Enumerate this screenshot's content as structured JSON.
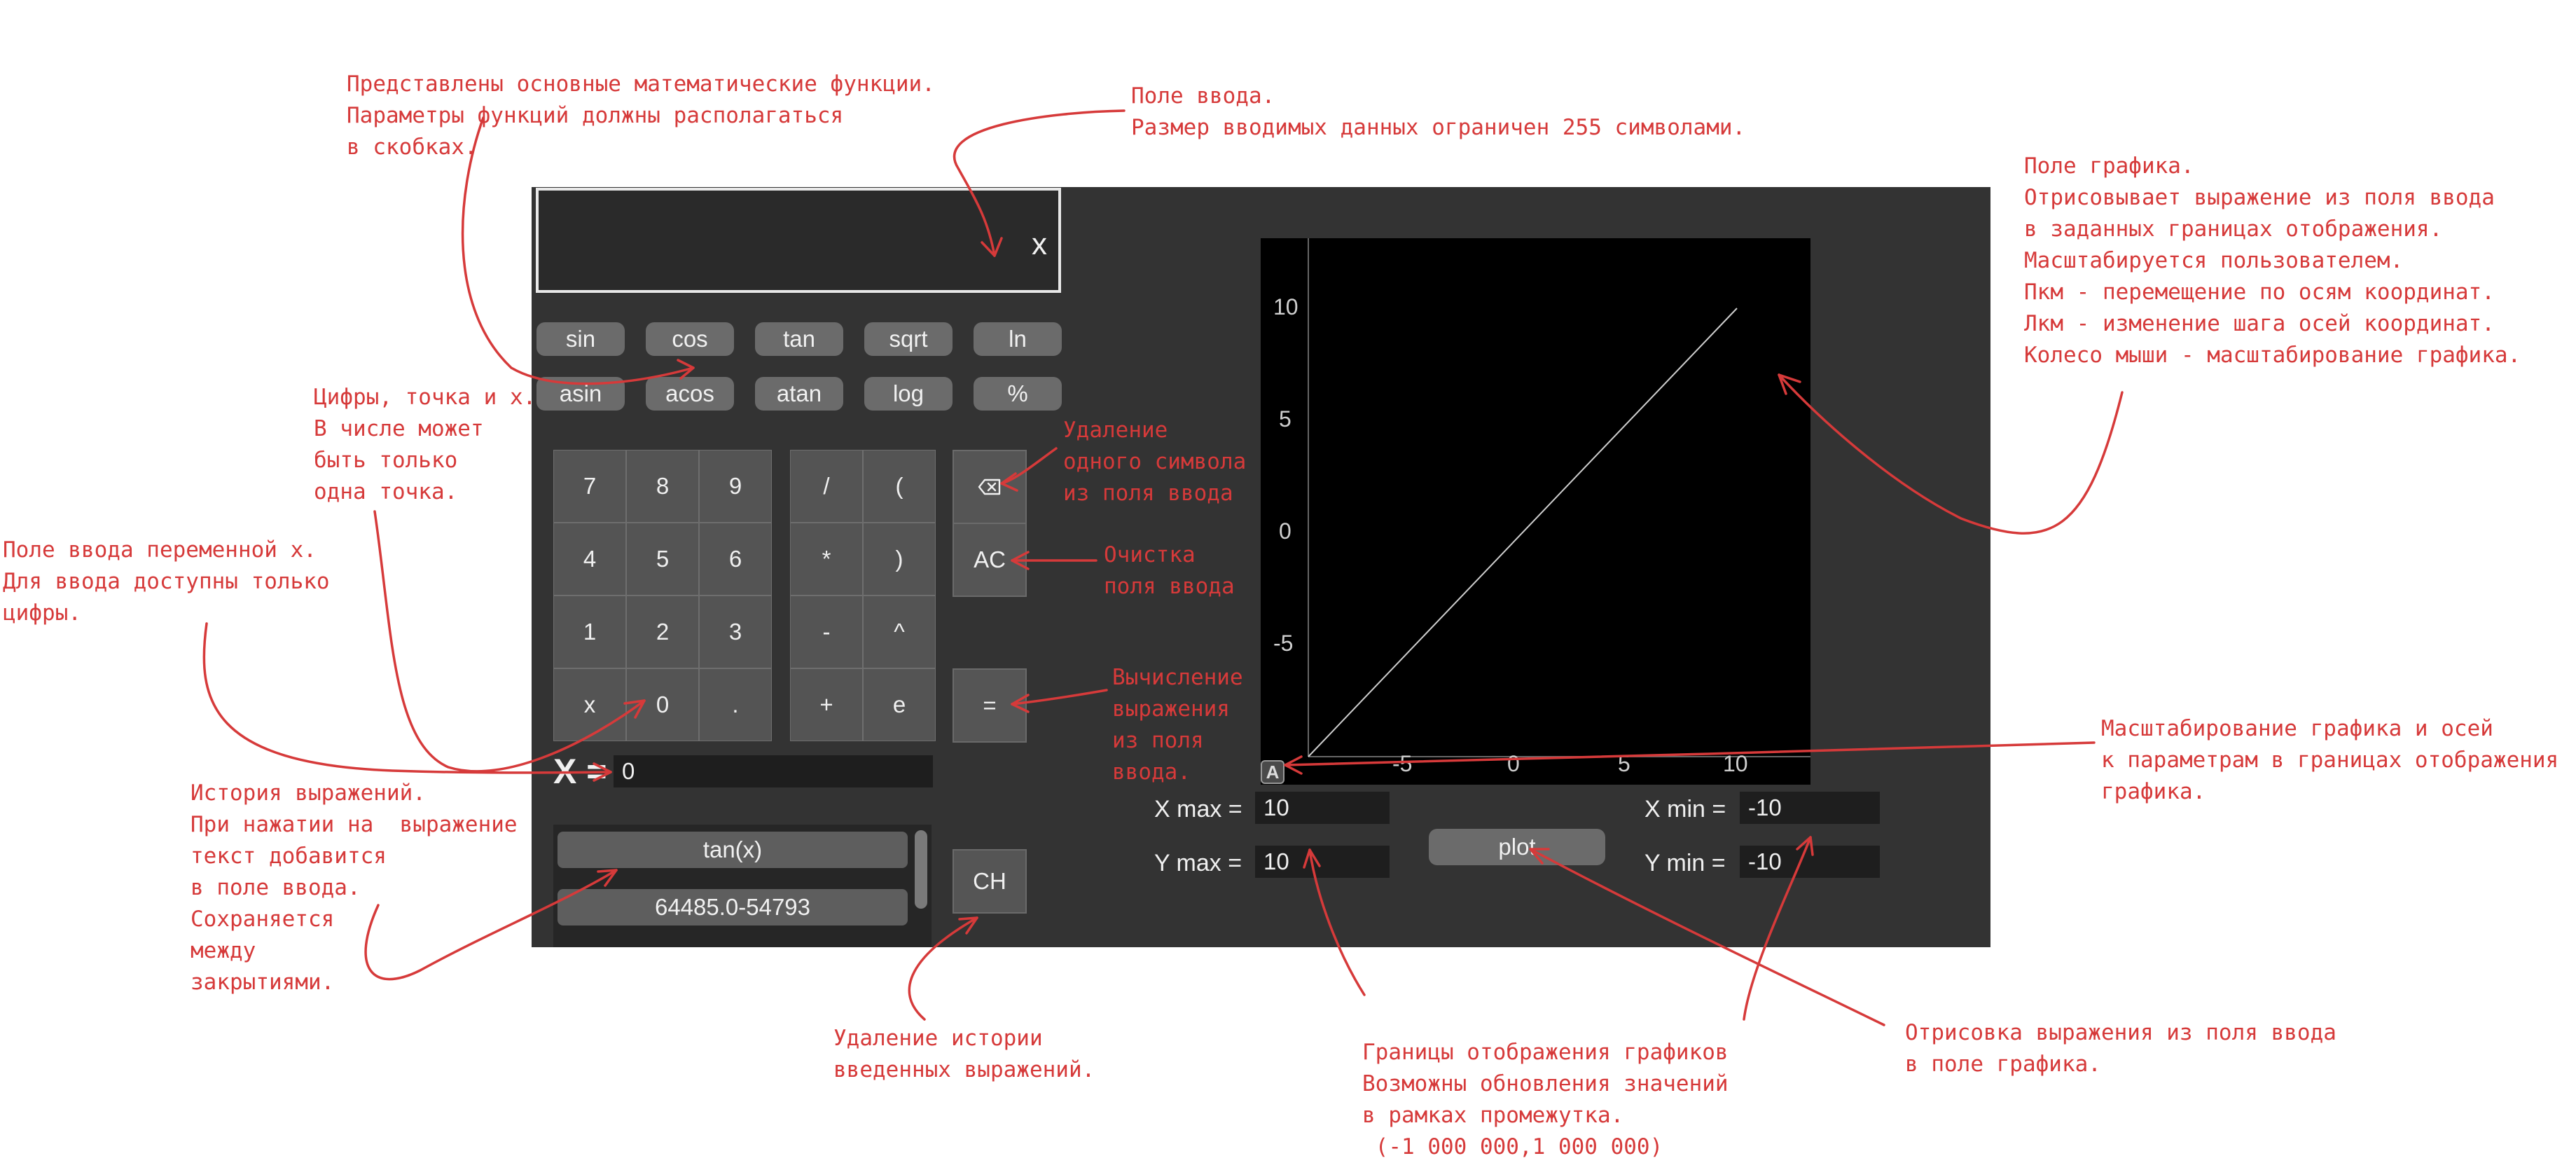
{
  "display": {
    "value": "x"
  },
  "functions": {
    "row1": [
      "sin",
      "cos",
      "tan",
      "sqrt",
      "ln"
    ],
    "row2": [
      "asin",
      "acos",
      "atan",
      "log",
      "%"
    ]
  },
  "digits": [
    "7",
    "8",
    "9",
    "4",
    "5",
    "6",
    "1",
    "2",
    "3",
    "x",
    "0",
    "."
  ],
  "operators": [
    "/",
    "(",
    "*",
    ")",
    "-",
    "^",
    "+",
    "e"
  ],
  "side": {
    "backspace_icon": "backspace-icon",
    "clear": "AC",
    "equals": "=",
    "clear_history": "CH"
  },
  "xinput": {
    "label": "X =",
    "value": "0"
  },
  "history": [
    "tan(x)",
    "64485.0-54793"
  ],
  "plot": {
    "x_ticks": [
      "-5",
      "0",
      "5",
      "10"
    ],
    "y_ticks": [
      "10",
      "5",
      "0",
      "-5"
    ],
    "badge": "A",
    "button": "plot",
    "xmax_label": "X max =",
    "xmax": "10",
    "ymax_label": "Y max =",
    "ymax": "10",
    "xmin_label": "X min =",
    "xmin": "-10",
    "ymin_label": "Y min =",
    "ymin": "-10"
  },
  "annotations": {
    "functions_note": "Представлены основные математические функции.\nПараметры функций должны располагаться\nв скобках.",
    "input_note": "Поле ввода.\nРазмер вводимых данных ограничен 255 символами.",
    "graph_note": "Поле графика.\nОтрисовывает выражение из поля ввода\nв заданных границах отображения.\nМасштабируется пользователем.\nПкм - перемещение по осям координат.\nЛкм - изменение шага осей координат.\nКолесо мыши - масштабирование графика.",
    "digits_note": "Цифры, точка и x.\nВ числе может\nбыть только\nодна точка.",
    "xvar_note": "Поле ввода переменной x.\nДля ввода доступны только\nцифры.",
    "delete_note": "Удаление\nодного символа\nиз поля ввода",
    "clear_note": "Очистка\nполя ввода",
    "calc_note": "Вычисление\nвыражения\nиз поля\nввода.",
    "scale_note": "Масштабирование графика и осей\nк параметрам в границах отображения\nграфика.",
    "history_note": "История выражений.\nПри нажатии на  выражение\nтекст добавится\nв поле ввода.\nСохраняется\nмежду\nзакрытиями.",
    "ch_note": "Удаление истории\nвведенных выражений.",
    "bounds_note": "Границы отображения графиков\nВозможны обновления значений\nв рамках промежутка.\n (-1 000 000,1 000 000)",
    "plot_note": "Отрисовка выражения из поля ввода\nв поле графика."
  }
}
